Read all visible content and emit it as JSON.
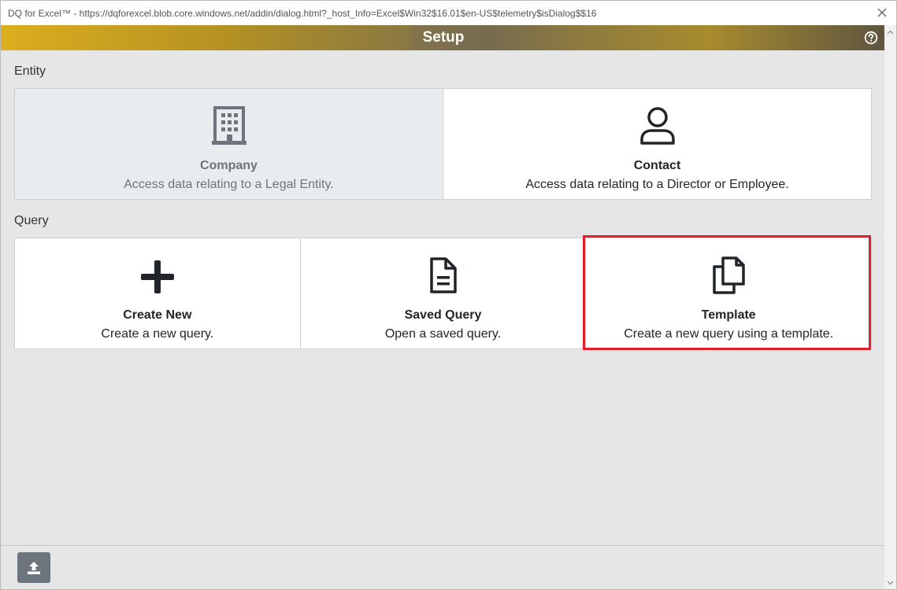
{
  "window": {
    "title": "DQ for Excel™ - https://dqforexcel.blob.core.windows.net/addin/dialog.html?_host_Info=Excel$Win32$16.01$en-US$telemetry$isDialog$$16"
  },
  "header": {
    "title": "Setup"
  },
  "entity": {
    "label": "Entity",
    "cards": [
      {
        "title": "Company",
        "desc": "Access data relating to a Legal Entity.",
        "icon": "building-icon",
        "selected": true
      },
      {
        "title": "Contact",
        "desc": "Access data relating to a Director or Employee.",
        "icon": "person-icon",
        "selected": false
      }
    ]
  },
  "query": {
    "label": "Query",
    "cards": [
      {
        "title": "Create New",
        "desc": "Create a new query.",
        "icon": "plus-icon"
      },
      {
        "title": "Saved Query",
        "desc": "Open a saved query.",
        "icon": "document-icon"
      },
      {
        "title": "Template",
        "desc": "Create a new query using a template.",
        "icon": "copy-icon"
      }
    ]
  },
  "footer": {
    "upload_icon": "upload-icon"
  },
  "colors": {
    "header_gold": "#dcae1f",
    "highlight": "#e0202a",
    "selected_card_bg": "#e9ecef",
    "button_gray": "#6c757d"
  }
}
